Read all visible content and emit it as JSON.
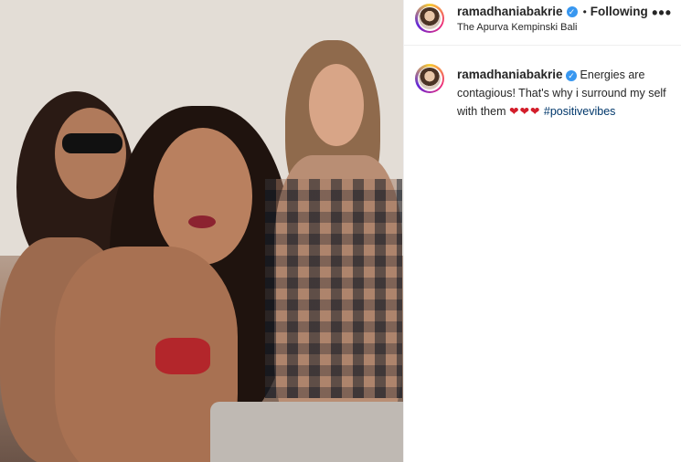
{
  "post": {
    "username": "ramadhaniabakrie",
    "verified_badge": "✓",
    "separator": "•",
    "follow_status": "Following",
    "location": "The Apurva Kempinski Bali",
    "more_icon": "•••",
    "caption_username": "ramadhaniabakrie",
    "caption_text": "Energies are contagious! That's why i surround my self with them",
    "caption_hearts": "❤❤❤",
    "hashtag": "#positivevibes"
  },
  "photo": {
    "description_icon": "photo",
    "colors": {
      "background": "#d6cfc8",
      "skin": "#b07a5b",
      "hair": "#2a1a14",
      "swimsuit_red": "#b3262b"
    }
  }
}
